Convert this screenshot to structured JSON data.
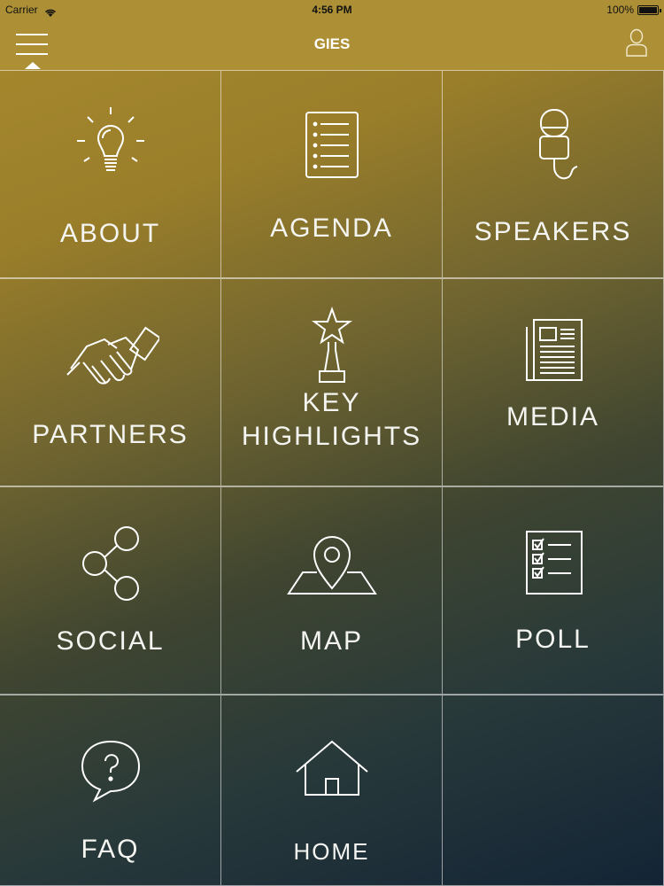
{
  "status_bar": {
    "carrier": "Carrier",
    "time": "4:56 PM",
    "battery": "100%"
  },
  "nav": {
    "title": "GIES",
    "menu_icon": "hamburger-menu-icon",
    "profile_icon": "user-profile-icon"
  },
  "tiles": [
    {
      "label": "ABOUT",
      "icon": "lightbulb-icon"
    },
    {
      "label": "AGENDA",
      "icon": "document-list-icon"
    },
    {
      "label": "SPEAKERS",
      "icon": "microphone-icon"
    },
    {
      "label": "PARTNERS",
      "icon": "handshake-icon"
    },
    {
      "label_line1": "KEY",
      "label_line2": "HIGHLIGHTS",
      "icon": "trophy-star-icon"
    },
    {
      "label": "MEDIA",
      "icon": "newspaper-icon"
    },
    {
      "label": "SOCIAL",
      "icon": "share-icon"
    },
    {
      "label": "MAP",
      "icon": "map-pin-icon"
    },
    {
      "label": "POLL",
      "icon": "checklist-icon"
    },
    {
      "label": "FAQ",
      "icon": "question-bubble-icon"
    },
    {
      "label": "HOME",
      "icon": "house-icon"
    }
  ],
  "colors": {
    "header": "#ad9035",
    "gradient_top": "#a88a2e",
    "gradient_bottom": "#132436"
  }
}
